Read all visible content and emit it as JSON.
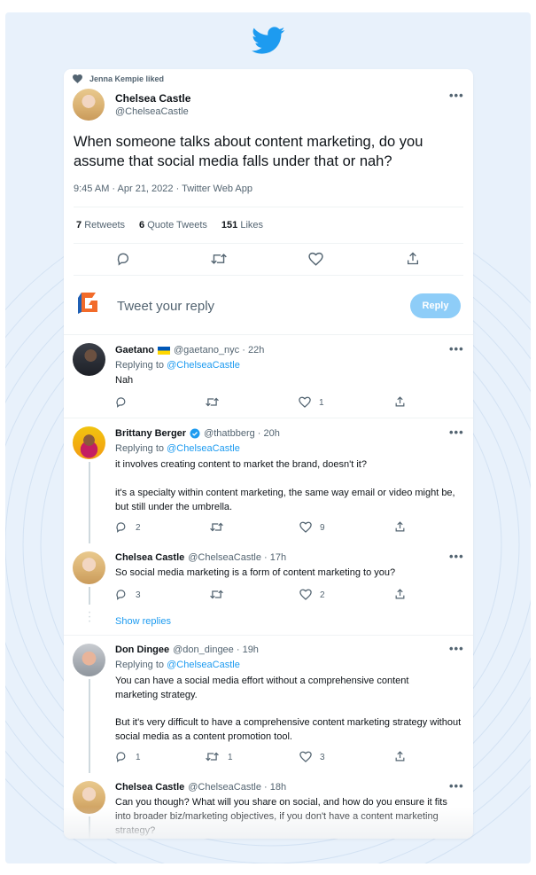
{
  "colors": {
    "background": "#e8f1fb",
    "accent": "#1d9bf0",
    "twitter_blue": "#1d9bf0",
    "reply_button": "#8ecdf8"
  },
  "icons": {
    "brand": "twitter-bird-icon",
    "liked": "heart-icon",
    "more": "more-icon",
    "reply": "reply-icon",
    "retweet": "retweet-icon",
    "like": "like-icon",
    "share": "share-icon",
    "verified": "verified-badge-icon",
    "flag": "ukraine-flag-icon"
  },
  "liked_by": "Jenna Kempie liked",
  "tweet": {
    "name": "Chelsea Castle",
    "handle": "@ChelseaCastle",
    "text": "When someone talks about content marketing, do you assume that social media falls under that or nah?",
    "meta": "9:45 AM · Apr 21, 2022 · Twitter Web App",
    "retweets_count": "7",
    "retweets_label": "Retweets",
    "quotes_count": "6",
    "quotes_label": "Quote Tweets",
    "likes_count": "151",
    "likes_label": "Likes"
  },
  "reply_box": {
    "placeholder": "Tweet your reply",
    "button": "Reply"
  },
  "replies": [
    {
      "name": "Gaetano",
      "meta": "@gaetano_nyc · 22h",
      "replying_prefix": "Replying to",
      "replying_to": "@ChelseaCastle",
      "text": "Nah",
      "reply_count": "",
      "retweet_count": "",
      "like_count": "1"
    },
    {
      "name": "Brittany Berger",
      "meta": "@thatbberg · 20h",
      "replying_prefix": "Replying to",
      "replying_to": "@ChelseaCastle",
      "text1": "it involves creating content to market the brand, doesn't it?",
      "text2": "it's a specialty within content marketing, the same way email or video might be, but still under the umbrella.",
      "reply_count": "2",
      "retweet_count": "",
      "like_count": "9"
    },
    {
      "name": "Chelsea Castle",
      "meta": "@ChelseaCastle · 17h",
      "text": "So social media marketing is a form of content marketing to you?",
      "reply_count": "3",
      "retweet_count": "",
      "like_count": "2",
      "show_replies": "Show replies"
    },
    {
      "name": "Don Dingee",
      "meta": "@don_dingee · 19h",
      "replying_prefix": "Replying to",
      "replying_to": "@ChelseaCastle",
      "text1": "You can have a social media effort without a comprehensive content marketing strategy.",
      "text2": "But it's very difficult to have a comprehensive content marketing strategy without social media as a content promotion tool.",
      "reply_count": "1",
      "retweet_count": "1",
      "like_count": "3"
    },
    {
      "name": "Chelsea Castle",
      "meta": "@ChelseaCastle · 18h",
      "text": "Can you though? What will you share on social, and how do you ensure it fits into broader biz/marketing objectives, if you don't have a content marketing strategy?"
    }
  ]
}
